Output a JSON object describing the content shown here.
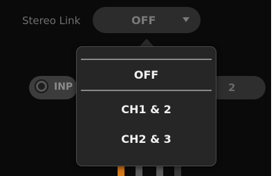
{
  "stereo_link": {
    "label": "Stereo Link",
    "value": "OFF"
  },
  "background": {
    "input_label": "INP",
    "right_value": "2"
  },
  "popup": {
    "options": [
      {
        "label": "OFF",
        "selected": true
      },
      {
        "label": "CH1 & 2",
        "selected": false
      },
      {
        "label": "CH2 & 3",
        "selected": false
      }
    ]
  },
  "colors": {
    "panel_bg": "#0a0a0a",
    "popup_bg": "#262626",
    "text_primary": "#f2f2f2",
    "text_muted": "#7a7a7a",
    "meter_orange": "#d87a1a"
  },
  "icons": [
    "chevron-down-icon",
    "input-jack-icon"
  ]
}
